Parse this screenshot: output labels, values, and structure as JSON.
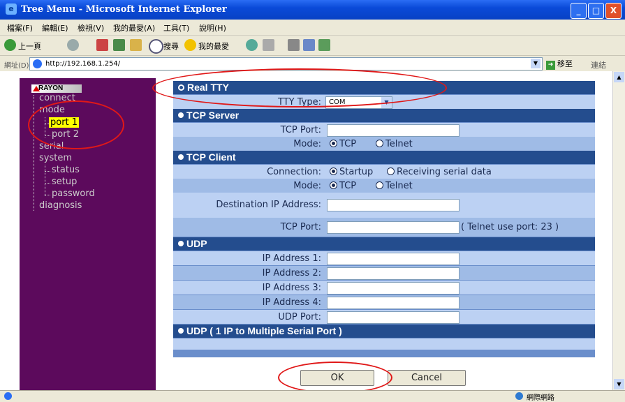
{
  "window": {
    "title": "Tree Menu - Microsoft Internet Explorer",
    "min": "_",
    "max": "□",
    "close": "X"
  },
  "menubar": [
    "檔案(F)",
    "編輯(E)",
    "檢視(V)",
    "我的最愛(A)",
    "工具(T)",
    "說明(H)"
  ],
  "toolbar": {
    "back": "上一頁",
    "search": "搜尋",
    "favorites": "我的最愛"
  },
  "address": {
    "label": "網址(D)",
    "url": "http://192.168.1.254/",
    "go": "移至",
    "links": "連結"
  },
  "status": {
    "zone": "網際網路"
  },
  "sidebar": {
    "logo": "RAYON",
    "items": [
      "connect",
      "mode",
      "port 1",
      "port 2",
      "serial",
      "system",
      "status",
      "setup",
      "password",
      "diagnosis"
    ]
  },
  "form": {
    "real_tty": {
      "title": "Real TTY",
      "tty_type_label": "TTY Type:",
      "tty_type_value": "COM"
    },
    "tcp_server": {
      "title": "TCP Server",
      "port_label": "TCP Port:",
      "mode_label": "Mode:",
      "opt_tcp": "TCP",
      "opt_telnet": "Telnet"
    },
    "tcp_client": {
      "title": "TCP Client",
      "conn_label": "Connection:",
      "opt_startup": "Startup",
      "opt_receiving": "Receiving serial data",
      "mode_label": "Mode:",
      "opt_tcp": "TCP",
      "opt_telnet": "Telnet",
      "dest_label": "Destination IP Address:",
      "port_label": "TCP Port:",
      "port_hint": "( Telnet use port: 23 )"
    },
    "udp": {
      "title": "UDP",
      "ip1": "IP Address 1:",
      "ip2": "IP Address 2:",
      "ip3": "IP Address 3:",
      "ip4": "IP Address 4:",
      "port_label": "UDP Port:"
    },
    "udp_multi": {
      "title": "UDP ( 1 IP to Multiple Serial Port )"
    }
  },
  "buttons": {
    "ok": "OK",
    "cancel": "Cancel"
  },
  "colors": {
    "sidebar": "#5c0a5c",
    "section": "#244d8e",
    "highlight": "#ffff00",
    "annotation": "#e01818"
  }
}
